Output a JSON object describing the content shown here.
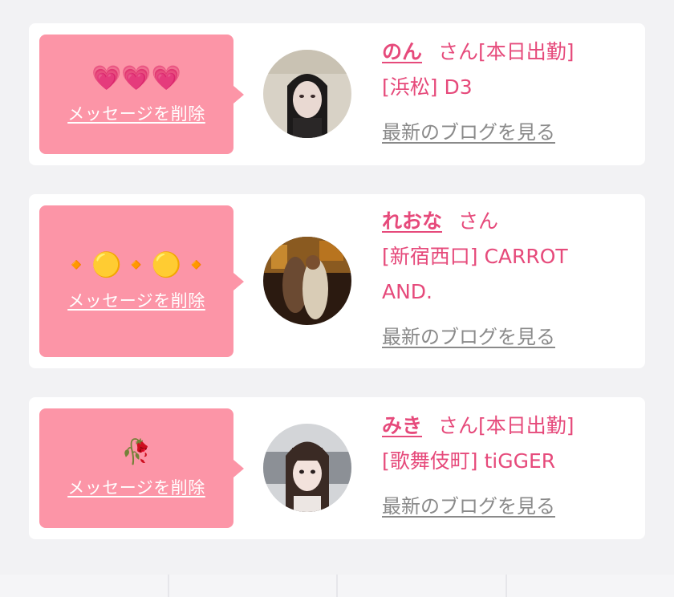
{
  "messages": [
    {
      "emoji": "💗💗💗",
      "delete_label": "メッセージを削除",
      "name": "のん",
      "suffix": "さん[本日出勤]",
      "line2": "[浜松] D3",
      "line3": "",
      "blog_label": "最新のブログを見る",
      "avatar_icon": "avatar-photo"
    },
    {
      "emoji": "🔸🟡🔸🟡🔸",
      "delete_label": "メッセージを削除",
      "name": "れおな",
      "suffix": "さん",
      "line2": "[新宿西口] CARROT",
      "line3": "AND.",
      "blog_label": "最新のブログを見る",
      "avatar_icon": "avatar-photo"
    },
    {
      "emoji": "🥀",
      "delete_label": "メッセージを削除",
      "name": "みき",
      "suffix": "さん[本日出勤]",
      "line2": "[歌舞伎町] tiGGER",
      "line3": "",
      "blog_label": "最新のブログを見る",
      "avatar_icon": "avatar-photo"
    }
  ],
  "colors": {
    "accent": "#e64a7b",
    "bubble": "#fc95a7",
    "link_gray": "#8a8a8a",
    "background": "#f2f2f4"
  }
}
